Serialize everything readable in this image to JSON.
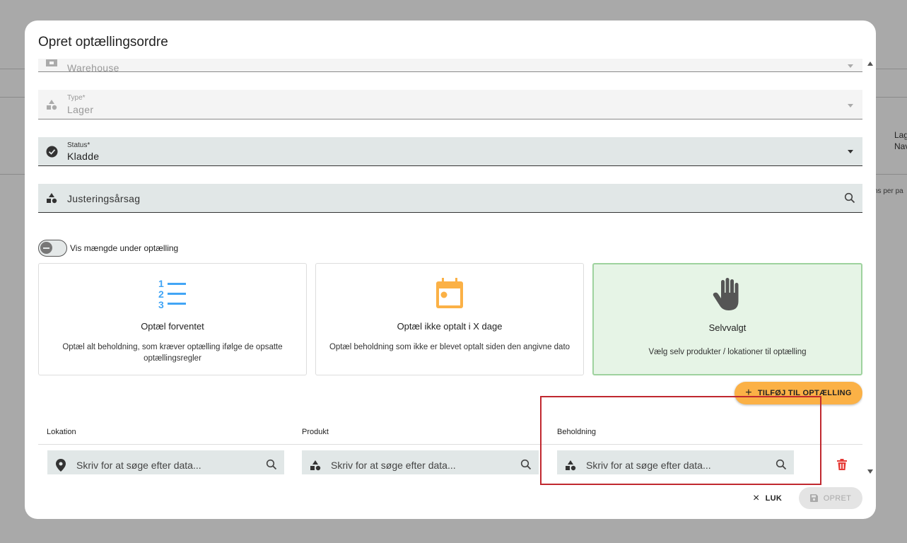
{
  "background": {
    "text_lag": "Lag",
    "text_nav": "Nav",
    "text_per_page": "ns per pa"
  },
  "dialog": {
    "title": "Opret optællingsordre",
    "fields": {
      "warehouse": {
        "label": "",
        "value": "Warehouse",
        "icon": "warehouse-icon"
      },
      "type": {
        "label": "Type*",
        "value": "Lager",
        "icon": "category-icon"
      },
      "status": {
        "label": "Status*",
        "value": "Kladde",
        "icon": "check-circle-icon"
      },
      "adjustment_reason": {
        "placeholder": "Justeringsårsag",
        "icon": "category-icon"
      }
    },
    "toggle": {
      "label": "Vis mængde under optælling",
      "checked": false
    },
    "cards": [
      {
        "title": "Optæl forventet",
        "description": "Optæl alt beholdning, som kræver optælling ifølge de opsatte optællingsregler",
        "icon": "numbered-list-icon",
        "color": "#42a5f5",
        "selected": false
      },
      {
        "title": "Optæl ikke optalt i X dage",
        "description": "Optæl beholdning som ikke er blevet optalt siden den angivne dato",
        "icon": "calendar-icon",
        "color": "#fbb146",
        "selected": false
      },
      {
        "title": "Selvvalgt",
        "description": "Vælg selv produkter / lokationer til optælling",
        "icon": "hand-icon",
        "color": "#555555",
        "selected": true
      }
    ],
    "add_button": {
      "label": "TILFØJ TIL OPTÆLLING",
      "icon": "plus-icon"
    },
    "table": {
      "columns": [
        "Lokation",
        "Produkt",
        "Beholdning"
      ],
      "row": {
        "location_placeholder": "Skriv for at søge efter data...",
        "product_placeholder": "Skriv for at søge efter data...",
        "stock_placeholder": "Skriv for at søge efter data..."
      }
    },
    "actions": {
      "close_label": "LUK",
      "create_label": "OPRET"
    },
    "colors": {
      "accent": "#fbb146",
      "selected_card_bg": "#e6f4e6",
      "delete": "#e53935",
      "highlight": "#c0282f"
    }
  }
}
